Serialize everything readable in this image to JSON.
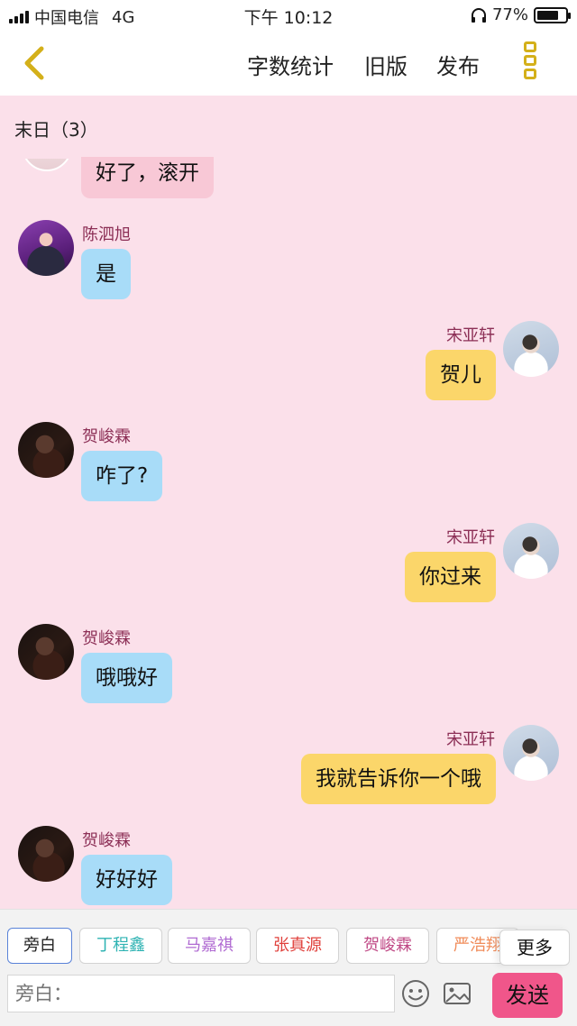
{
  "status_bar": {
    "carrier": "中国电信",
    "network": "4G",
    "time": "下午 10:12",
    "battery_percent": "77%",
    "battery_level": 0.77
  },
  "nav": {
    "back_icon": "chevron-left-icon",
    "actions": [
      "字数统计",
      "旧版",
      "发布"
    ],
    "more_icon": "more-dots-icon",
    "accent": "#d4b01a"
  },
  "chat": {
    "title": "末日（3）",
    "messages": [
      {
        "side": "left",
        "sender": "",
        "text": "好了，滚开",
        "partial": true
      },
      {
        "side": "left",
        "sender": "陈泗旭",
        "text": "是"
      },
      {
        "side": "right",
        "sender": "宋亚轩",
        "text": "贺儿"
      },
      {
        "side": "left",
        "sender": "贺峻霖",
        "text": "咋了?"
      },
      {
        "side": "right",
        "sender": "宋亚轩",
        "text": "你过来"
      },
      {
        "side": "left",
        "sender": "贺峻霖",
        "text": "哦哦好"
      },
      {
        "side": "right",
        "sender": "宋亚轩",
        "text": "我就告诉你一个哦"
      },
      {
        "side": "left",
        "sender": "贺峻霖",
        "text": "好好好"
      }
    ]
  },
  "composer": {
    "role_tags": [
      {
        "label": "旁白",
        "color": "#222222",
        "selected": true
      },
      {
        "label": "丁程鑫",
        "color": "#2fb3b3"
      },
      {
        "label": "马嘉祺",
        "color": "#b06bd2"
      },
      {
        "label": "张真源",
        "color": "#e0413c"
      },
      {
        "label": "贺峻霖",
        "color": "#c04a86"
      },
      {
        "label": "严浩翔",
        "color": "#f08c5a"
      }
    ],
    "more_label": "更多",
    "input_placeholder": "旁白：",
    "emoji_icon": "smiley-icon",
    "image_icon": "image-icon",
    "send_label": "发送",
    "send_color": "#f0568a"
  }
}
